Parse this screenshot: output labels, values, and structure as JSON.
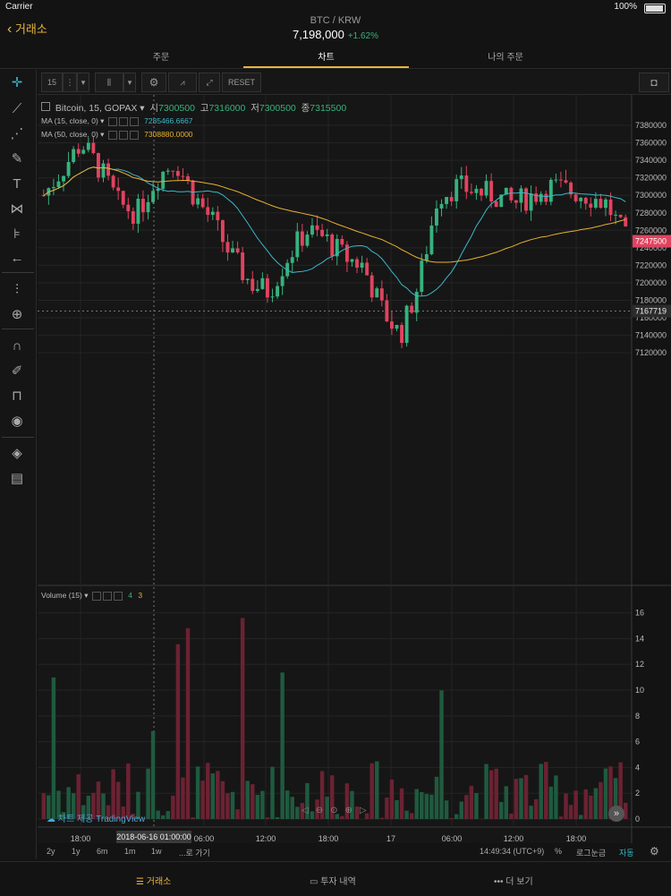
{
  "status": {
    "carrier": "Carrier",
    "time": "",
    "battery": "100%"
  },
  "header": {
    "back_label": "거래소",
    "pair": "BTC / KRW",
    "price": "7,198,000",
    "change": "+1.62%"
  },
  "tabs": [
    {
      "label": "주문"
    },
    {
      "label": "차트"
    },
    {
      "label": "나의 주문"
    }
  ],
  "toolbar": {
    "interval": "15",
    "reset": "RESET"
  },
  "legend": {
    "symbol": "Bitcoin, 15, GOPAX",
    "open_label": "시",
    "open": "7300500",
    "high_label": "고",
    "high": "7316000",
    "low_label": "저",
    "low": "7300500",
    "close_label": "종",
    "close": "7315500",
    "ma1_label": "MA (15, close, 0)",
    "ma1_value": "7285466.6667",
    "ma2_label": "MA (50, close, 0)",
    "ma2_value": "7308880.0000",
    "volume_label": "Volume (15)",
    "vol_a": "4",
    "vol_b": "3"
  },
  "price_axis": {
    "ticks": [
      "7380000",
      "7360000",
      "7340000",
      "7320000",
      "7300000",
      "7280000",
      "7260000",
      "7240000",
      "7220000",
      "7200000",
      "7180000",
      "7160000",
      "7140000",
      "7120000"
    ],
    "last_price": "7247500",
    "cross_price": "7167719"
  },
  "volume_axis": {
    "ticks": [
      "16",
      "14",
      "12",
      "10",
      "8",
      "6",
      "4",
      "2",
      "0"
    ]
  },
  "time_axis": {
    "ticks": [
      "18:00",
      "06:00",
      "12:00",
      "18:00",
      "17",
      "06:00",
      "12:00",
      "18:00"
    ],
    "cross_time": "2018-06-16 01:00:00"
  },
  "watermark": "차트 제공 TradingView",
  "range_buttons": [
    "2y",
    "1y",
    "6m",
    "1m",
    "1w",
    "...로 가기"
  ],
  "clock": "14:49:34 (UTC+9)",
  "range_right": {
    "pct": "%",
    "log": "로그눈금",
    "auto": "자동"
  },
  "bottom_nav": [
    {
      "label": "거래소"
    },
    {
      "label": "투자 내역"
    },
    {
      "label": "더 보기"
    }
  ],
  "colors": {
    "up": "#36b27e",
    "down": "#e0435e",
    "accent": "#e9b53e",
    "ma15": "#39b8c9",
    "ma50": "#e8b131"
  }
}
